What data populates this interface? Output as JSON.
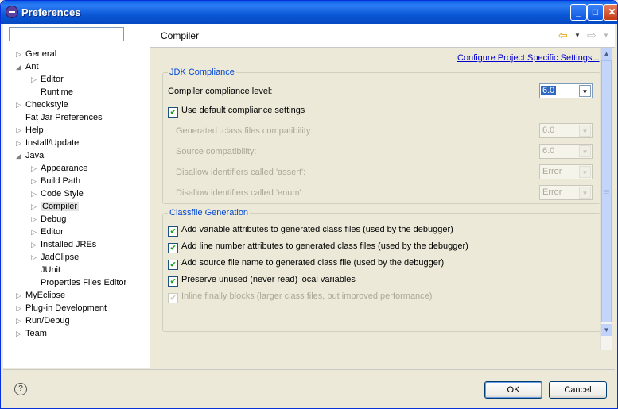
{
  "window": {
    "title": "Preferences"
  },
  "tree": [
    {
      "label": "General",
      "twisty": "▷",
      "indent": 0
    },
    {
      "label": "Ant",
      "twisty": "◢",
      "indent": 0
    },
    {
      "label": "Editor",
      "twisty": "▷",
      "indent": 1
    },
    {
      "label": "Runtime",
      "twisty": "",
      "indent": 1
    },
    {
      "label": "Checkstyle",
      "twisty": "▷",
      "indent": 0
    },
    {
      "label": "Fat Jar Preferences",
      "twisty": "",
      "indent": 0
    },
    {
      "label": "Help",
      "twisty": "▷",
      "indent": 0
    },
    {
      "label": "Install/Update",
      "twisty": "▷",
      "indent": 0
    },
    {
      "label": "Java",
      "twisty": "◢",
      "indent": 0
    },
    {
      "label": "Appearance",
      "twisty": "▷",
      "indent": 1
    },
    {
      "label": "Build Path",
      "twisty": "▷",
      "indent": 1
    },
    {
      "label": "Code Style",
      "twisty": "▷",
      "indent": 1
    },
    {
      "label": "Compiler",
      "twisty": "▷",
      "indent": 1,
      "selected": true
    },
    {
      "label": "Debug",
      "twisty": "▷",
      "indent": 1
    },
    {
      "label": "Editor",
      "twisty": "▷",
      "indent": 1
    },
    {
      "label": "Installed JREs",
      "twisty": "▷",
      "indent": 1
    },
    {
      "label": "JadClipse",
      "twisty": "▷",
      "indent": 1
    },
    {
      "label": "JUnit",
      "twisty": "",
      "indent": 1
    },
    {
      "label": "Properties Files Editor",
      "twisty": "",
      "indent": 1
    },
    {
      "label": "MyEclipse",
      "twisty": "▷",
      "indent": 0
    },
    {
      "label": "Plug-in Development",
      "twisty": "▷",
      "indent": 0
    },
    {
      "label": "Run/Debug",
      "twisty": "▷",
      "indent": 0
    },
    {
      "label": "Team",
      "twisty": "▷",
      "indent": 0
    }
  ],
  "page": {
    "title": "Compiler",
    "configure_link": "Configure Project Specific Settings..."
  },
  "jdk": {
    "legend": "JDK Compliance",
    "compliance_label": "Compiler compliance level:",
    "compliance_value": "6.0",
    "use_default_label": "Use default compliance settings",
    "generated_label": "Generated .class files compatibility:",
    "generated_value": "6.0",
    "source_label": "Source compatibility:",
    "source_value": "6.0",
    "assert_label": "Disallow identifiers called 'assert':",
    "assert_value": "Error",
    "enum_label": "Disallow identifiers called 'enum':",
    "enum_value": "Error"
  },
  "classfile": {
    "legend": "Classfile Generation",
    "opt1": "Add variable attributes to generated class files (used by the debugger)",
    "opt2": "Add line number attributes to generated class files (used by the debugger)",
    "opt3": "Add source file name to generated class file (used by the debugger)",
    "opt4": "Preserve unused (never read) local variables",
    "opt5": "Inline finally blocks (larger class files, but improved performance)"
  },
  "footer": {
    "ok_label": "OK",
    "cancel_label": "Cancel"
  },
  "glyphs": {
    "check": "✔",
    "min": "_",
    "max": "□",
    "close": "✕",
    "help": "?",
    "back": "⇦",
    "fwd": "⇨",
    "dd": "▼",
    "up": "▲"
  }
}
